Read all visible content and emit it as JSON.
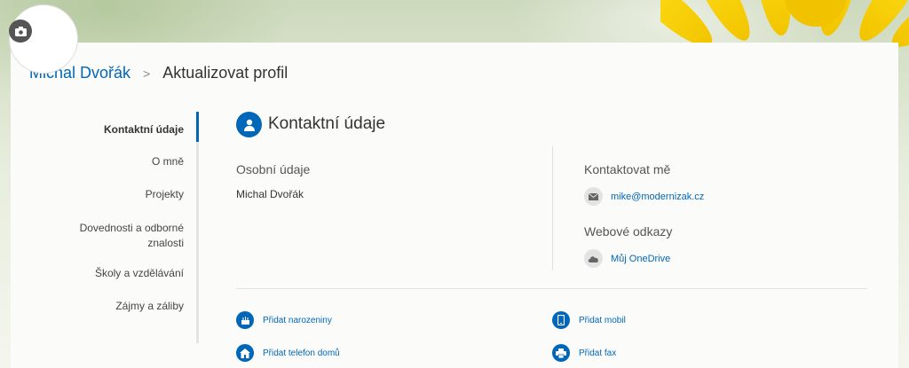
{
  "breadcrumb": {
    "profile_name": "Michal Dvořák",
    "separator": ">",
    "current": "Aktualizovat profil"
  },
  "avatar": {
    "camera_icon": "camera-icon"
  },
  "sidebar": {
    "items": [
      {
        "label": "Kontaktní údaje",
        "active": true
      },
      {
        "label": "O mně"
      },
      {
        "label": "Projekty"
      },
      {
        "label": "Dovednosti a odborné znalosti"
      },
      {
        "label": "Školy a vzdělávání"
      },
      {
        "label": "Zájmy a záliby"
      }
    ]
  },
  "section": {
    "title": "Kontaktní údaje",
    "icon": "person-icon"
  },
  "personal": {
    "title": "Osobní údaje",
    "name": "Michal Dvořák"
  },
  "contact": {
    "title": "Kontaktovat mě",
    "email": "mike@modernizak.cz",
    "email_icon": "mail-icon"
  },
  "links": {
    "title": "Webové odkazy",
    "onedrive": "Můj OneDrive",
    "onedrive_icon": "cloud-icon"
  },
  "add_actions": {
    "birthday": "Přidat narozeniny",
    "mobile": "Přidat mobil",
    "home_phone": "Přidat telefon domů",
    "fax": "Přidat fax"
  },
  "colors": {
    "accent": "#0067b8",
    "text": "#333333",
    "flower": "#ffe21a"
  }
}
